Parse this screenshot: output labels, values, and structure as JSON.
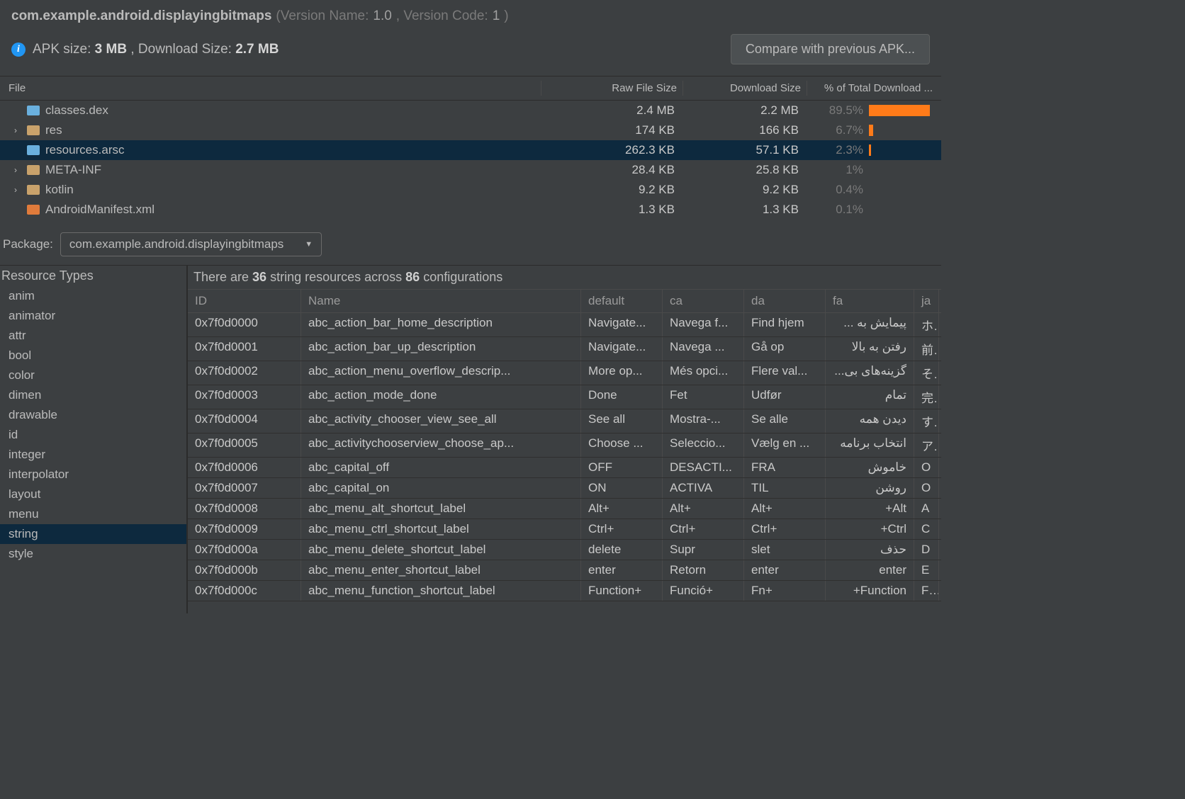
{
  "header": {
    "package": "com.example.android.displayingbitmaps",
    "version_name_label": " (Version Name: ",
    "version_name": "1.0",
    "version_code_label": ", Version Code: ",
    "version_code": "1",
    "paren_close": ")",
    "apk_size_label": "APK size: ",
    "apk_size": "3 MB",
    "download_size_label": ", Download Size: ",
    "download_size": "2.7 MB",
    "compare_btn": "Compare with previous APK..."
  },
  "file_tree": {
    "headers": {
      "c1": "File",
      "c2": "Raw File Size",
      "c3": "Download Size",
      "c4": "% of Total Download ..."
    },
    "rows": [
      {
        "name": "classes.dex",
        "raw": "2.4 MB",
        "dl": "2.2 MB",
        "pct": "89.5%",
        "bar": 100,
        "expandable": false,
        "icon": "dex",
        "selected": false
      },
      {
        "name": "res",
        "raw": "174 KB",
        "dl": "166 KB",
        "pct": "6.7%",
        "bar": 7,
        "expandable": true,
        "icon": "folder",
        "selected": false
      },
      {
        "name": "resources.arsc",
        "raw": "262.3 KB",
        "dl": "57.1 KB",
        "pct": "2.3%",
        "bar": 3,
        "expandable": false,
        "icon": "arsc",
        "selected": true
      },
      {
        "name": "META-INF",
        "raw": "28.4 KB",
        "dl": "25.8 KB",
        "pct": "1%",
        "bar": 0,
        "expandable": true,
        "icon": "folder",
        "selected": false
      },
      {
        "name": "kotlin",
        "raw": "9.2 KB",
        "dl": "9.2 KB",
        "pct": "0.4%",
        "bar": 0,
        "expandable": true,
        "icon": "folder",
        "selected": false
      },
      {
        "name": "AndroidManifest.xml",
        "raw": "1.3 KB",
        "dl": "1.3 KB",
        "pct": "0.1%",
        "bar": 0,
        "expandable": false,
        "icon": "xml",
        "selected": false
      }
    ]
  },
  "package_row": {
    "label": "Package:",
    "value": "com.example.android.displayingbitmaps"
  },
  "resource_types": {
    "title": "Resource Types",
    "items": [
      "anim",
      "animator",
      "attr",
      "bool",
      "color",
      "dimen",
      "drawable",
      "id",
      "integer",
      "interpolator",
      "layout",
      "menu",
      "string",
      "style"
    ],
    "selected": "string"
  },
  "resource_summary": {
    "prefix": "There are ",
    "count": "36",
    "mid": " string resources across ",
    "cfg": "86",
    "suffix": " configurations"
  },
  "strings_table": {
    "headers": [
      "ID",
      "Name",
      "default",
      "ca",
      "da",
      "fa",
      "ja"
    ],
    "rows": [
      {
        "id": "0x7f0d0000",
        "name": "abc_action_bar_home_description",
        "default": "Navigate...",
        "ca": "Navega f...",
        "da": "Find hjem",
        "fa": "پیمایش به ...",
        "ja": "ホ"
      },
      {
        "id": "0x7f0d0001",
        "name": "abc_action_bar_up_description",
        "default": "Navigate...",
        "ca": "Navega ...",
        "da": "Gå op",
        "fa": "رفتن به بالا",
        "ja": "前"
      },
      {
        "id": "0x7f0d0002",
        "name": "abc_action_menu_overflow_descrip...",
        "default": "More op...",
        "ca": "Més opci...",
        "da": "Flere val...",
        "fa": "گزینه‌های بی...",
        "ja": "そ"
      },
      {
        "id": "0x7f0d0003",
        "name": "abc_action_mode_done",
        "default": "Done",
        "ca": "Fet",
        "da": "Udfør",
        "fa": "تمام",
        "ja": "完"
      },
      {
        "id": "0x7f0d0004",
        "name": "abc_activity_chooser_view_see_all",
        "default": "See all",
        "ca": "Mostra-...",
        "da": "Se alle",
        "fa": "دیدن همه",
        "ja": "す"
      },
      {
        "id": "0x7f0d0005",
        "name": "abc_activitychooserview_choose_ap...",
        "default": "Choose ...",
        "ca": "Seleccio...",
        "da": "Vælg en ...",
        "fa": "انتخاب برنامه",
        "ja": "ア"
      },
      {
        "id": "0x7f0d0006",
        "name": "abc_capital_off",
        "default": "OFF",
        "ca": "DESACTI...",
        "da": "FRA",
        "fa": "خاموش",
        "ja": "O"
      },
      {
        "id": "0x7f0d0007",
        "name": "abc_capital_on",
        "default": "ON",
        "ca": "ACTIVA",
        "da": "TIL",
        "fa": "روشن",
        "ja": "O"
      },
      {
        "id": "0x7f0d0008",
        "name": "abc_menu_alt_shortcut_label",
        "default": "Alt+",
        "ca": "Alt+",
        "da": "Alt+",
        "fa": "Alt+",
        "ja": "A"
      },
      {
        "id": "0x7f0d0009",
        "name": "abc_menu_ctrl_shortcut_label",
        "default": "Ctrl+",
        "ca": "Ctrl+",
        "da": "Ctrl+",
        "fa": "Ctrl+",
        "ja": "C"
      },
      {
        "id": "0x7f0d000a",
        "name": "abc_menu_delete_shortcut_label",
        "default": "delete",
        "ca": "Supr",
        "da": "slet",
        "fa": "حذف",
        "ja": "D"
      },
      {
        "id": "0x7f0d000b",
        "name": "abc_menu_enter_shortcut_label",
        "default": "enter",
        "ca": "Retorn",
        "da": "enter",
        "fa": "enter",
        "ja": "E"
      },
      {
        "id": "0x7f0d000c",
        "name": "abc_menu_function_shortcut_label",
        "default": "Function+",
        "ca": "Funció+",
        "da": "Fn+",
        "fa": "Function+",
        "ja": "Fu"
      }
    ]
  }
}
